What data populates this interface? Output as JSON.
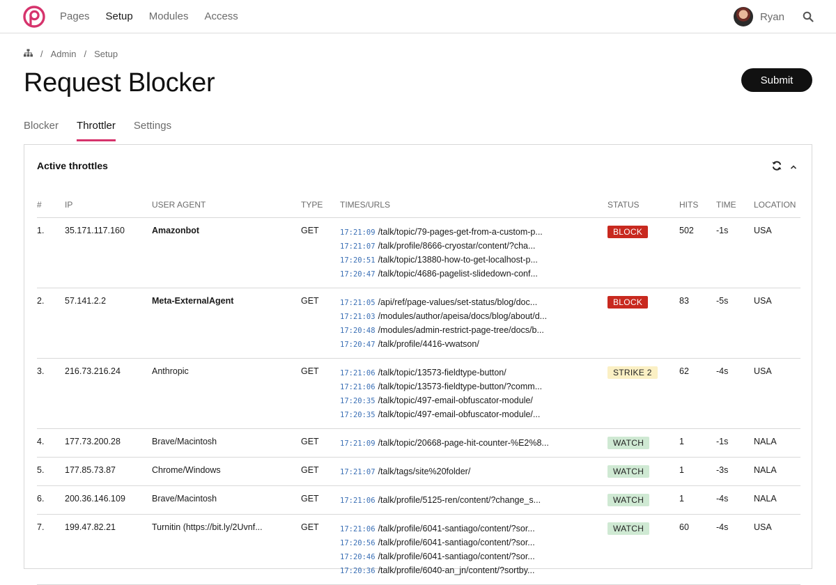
{
  "nav": {
    "items": [
      "Pages",
      "Setup",
      "Modules",
      "Access"
    ],
    "active": 1
  },
  "user": {
    "name": "Ryan"
  },
  "breadcrumb": {
    "items": [
      "Admin",
      "Setup"
    ],
    "separator": "/"
  },
  "page": {
    "title": "Request Blocker",
    "submit_label": "Submit"
  },
  "tabs": {
    "items": [
      "Blocker",
      "Throttler",
      "Settings"
    ],
    "active": 1
  },
  "panel": {
    "title": "Active throttles"
  },
  "table": {
    "headers": [
      "#",
      "IP",
      "USER AGENT",
      "TYPE",
      "TIMES/URLS",
      "STATUS",
      "HITS",
      "TIME",
      "LOCATION"
    ],
    "rows": [
      {
        "num": "1.",
        "ip": "35.171.117.160",
        "agent": "Amazonbot",
        "bold": true,
        "type": "GET",
        "urls": [
          {
            "time": "17:21:09",
            "url": "/talk/topic/79-pages-get-from-a-custom-p..."
          },
          {
            "time": "17:21:07",
            "url": "/talk/profile/8666-cryostar/content/?cha..."
          },
          {
            "time": "17:20:51",
            "url": "/talk/topic/13880-how-to-get-localhost-p..."
          },
          {
            "time": "17:20:47",
            "url": "/talk/topic/4686-pagelist-slidedown-conf..."
          }
        ],
        "status": "BLOCK",
        "status_kind": "block",
        "hits": "502",
        "time": "-1s",
        "location": "USA"
      },
      {
        "num": "2.",
        "ip": "57.141.2.2",
        "agent": "Meta-ExternalAgent",
        "bold": true,
        "type": "GET",
        "urls": [
          {
            "time": "17:21:05",
            "url": "/api/ref/page-values/set-status/blog/doc..."
          },
          {
            "time": "17:21:03",
            "url": "/modules/author/apeisa/docs/blog/about/d..."
          },
          {
            "time": "17:20:48",
            "url": "/modules/admin-restrict-page-tree/docs/b..."
          },
          {
            "time": "17:20:47",
            "url": "/talk/profile/4416-vwatson/"
          }
        ],
        "status": "BLOCK",
        "status_kind": "block",
        "hits": "83",
        "time": "-5s",
        "location": "USA"
      },
      {
        "num": "3.",
        "ip": "216.73.216.24",
        "agent": "Anthropic",
        "bold": false,
        "type": "GET",
        "urls": [
          {
            "time": "17:21:06",
            "url": "/talk/topic/13573-fieldtype-button/"
          },
          {
            "time": "17:21:06",
            "url": "/talk/topic/13573-fieldtype-button/?comm..."
          },
          {
            "time": "17:20:35",
            "url": "/talk/topic/497-email-obfuscator-module/"
          },
          {
            "time": "17:20:35",
            "url": "/talk/topic/497-email-obfuscator-module/..."
          }
        ],
        "status": "STRIKE 2",
        "status_kind": "strike",
        "hits": "62",
        "time": "-4s",
        "location": "USA"
      },
      {
        "num": "4.",
        "ip": "177.73.200.28",
        "agent": "Brave/Macintosh",
        "bold": false,
        "type": "GET",
        "urls": [
          {
            "time": "17:21:09",
            "url": "/talk/topic/20668-page-hit-counter-%E2%8..."
          }
        ],
        "status": "WATCH",
        "status_kind": "watch",
        "hits": "1",
        "time": "-1s",
        "location": "NALA"
      },
      {
        "num": "5.",
        "ip": "177.85.73.87",
        "agent": "Chrome/Windows",
        "bold": false,
        "type": "GET",
        "urls": [
          {
            "time": "17:21:07",
            "url": "/talk/tags/site%20folder/"
          }
        ],
        "status": "WATCH",
        "status_kind": "watch",
        "hits": "1",
        "time": "-3s",
        "location": "NALA"
      },
      {
        "num": "6.",
        "ip": "200.36.146.109",
        "agent": "Brave/Macintosh",
        "bold": false,
        "type": "GET",
        "urls": [
          {
            "time": "17:21:06",
            "url": "/talk/profile/5125-ren/content/?change_s..."
          }
        ],
        "status": "WATCH",
        "status_kind": "watch",
        "hits": "1",
        "time": "-4s",
        "location": "NALA"
      },
      {
        "num": "7.",
        "ip": "199.47.82.21",
        "agent": "Turnitin (https://bit.ly/2Uvnf...",
        "bold": false,
        "type": "GET",
        "urls": [
          {
            "time": "17:21:06",
            "url": "/talk/profile/6041-santiago/content/?sor..."
          },
          {
            "time": "17:20:56",
            "url": "/talk/profile/6041-santiago/content/?sor..."
          },
          {
            "time": "17:20:46",
            "url": "/talk/profile/6041-santiago/content/?sor..."
          },
          {
            "time": "17:20:36",
            "url": "/talk/profile/6040-an_jn/content/?sortby..."
          }
        ],
        "status": "WATCH",
        "status_kind": "watch",
        "hits": "60",
        "time": "-4s",
        "location": "USA"
      }
    ]
  },
  "colors": {
    "accent": "#d6336c",
    "logo": "#d6336c",
    "time_link": "#3a6fb5",
    "block": "#c8291f",
    "strike": "#fbf0c4",
    "watch": "#cfe9d3"
  },
  "icons": {
    "logo": "processwire-logo-icon",
    "home": "sitemap-icon",
    "search": "search-icon",
    "refresh": "refresh-icon",
    "collapse": "chevron-up-icon"
  }
}
